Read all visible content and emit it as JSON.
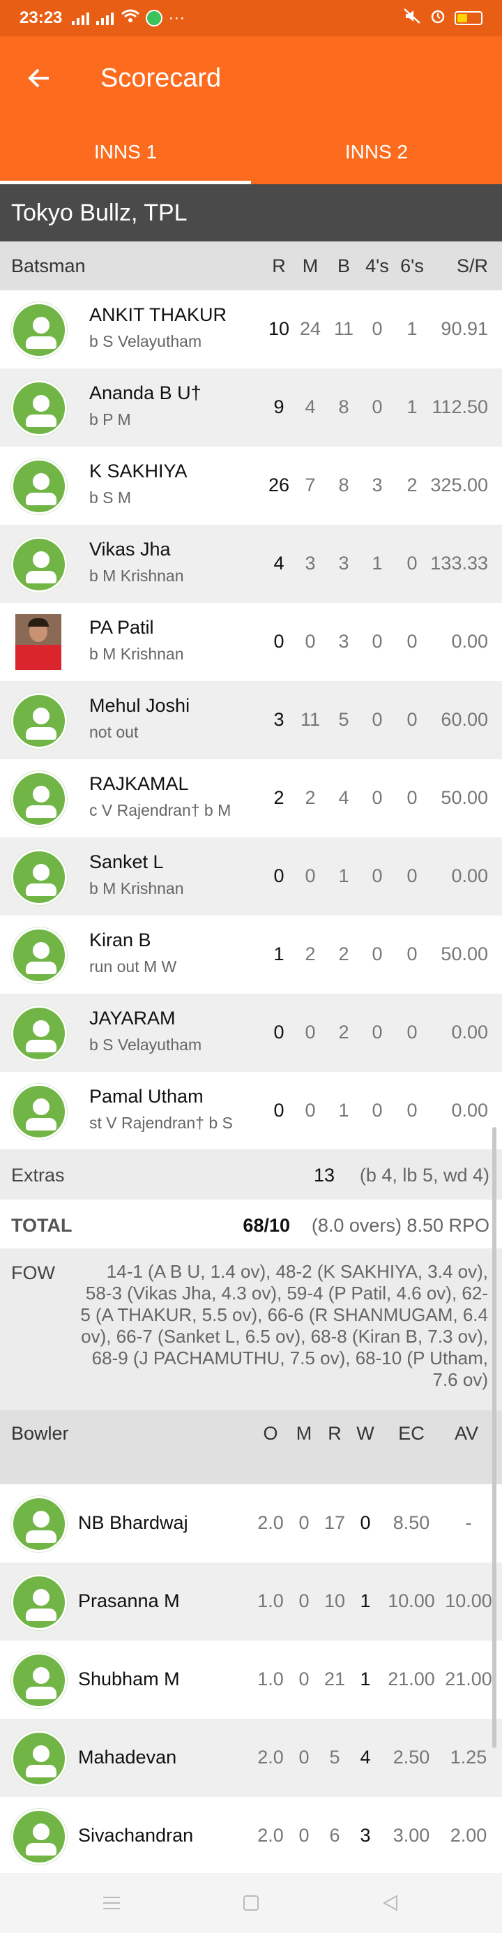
{
  "status": {
    "time": "23:23",
    "more": "···"
  },
  "header": {
    "title": "Scorecard"
  },
  "tabs": [
    {
      "label": "INNS 1",
      "active": true
    },
    {
      "label": "INNS 2",
      "active": false
    }
  ],
  "team_name": "Tokyo Bullz, TPL",
  "batting": {
    "headers": {
      "player": "Batsman",
      "r": "R",
      "m": "M",
      "b": "B",
      "fours": "4's",
      "sixes": "6's",
      "sr": "S/R"
    },
    "rows": [
      {
        "name": "ANKIT THAKUR",
        "dismissal": "b S Velayutham",
        "r": "10",
        "m": "24",
        "b": "11",
        "fours": "0",
        "sixes": "1",
        "sr": "90.91",
        "avatar": "default"
      },
      {
        "name": "Ananda B U†",
        "dismissal": "b P M",
        "r": "9",
        "m": "4",
        "b": "8",
        "fours": "0",
        "sixes": "1",
        "sr": "112.50",
        "avatar": "default"
      },
      {
        "name": "K SAKHIYA",
        "dismissal": "b S M",
        "r": "26",
        "m": "7",
        "b": "8",
        "fours": "3",
        "sixes": "2",
        "sr": "325.00",
        "avatar": "default"
      },
      {
        "name": "Vikas Jha",
        "dismissal": "b M Krishnan",
        "r": "4",
        "m": "3",
        "b": "3",
        "fours": "1",
        "sixes": "0",
        "sr": "133.33",
        "avatar": "default"
      },
      {
        "name": "PA Patil",
        "dismissal": "b M Krishnan",
        "r": "0",
        "m": "0",
        "b": "3",
        "fours": "0",
        "sixes": "0",
        "sr": "0.00",
        "avatar": "photo"
      },
      {
        "name": "Mehul Joshi",
        "dismissal": "not out",
        "r": "3",
        "m": "11",
        "b": "5",
        "fours": "0",
        "sixes": "0",
        "sr": "60.00",
        "avatar": "default"
      },
      {
        "name": "RAJKAMAL",
        "dismissal": "c V Rajendran† b M",
        "r": "2",
        "m": "2",
        "b": "4",
        "fours": "0",
        "sixes": "0",
        "sr": "50.00",
        "avatar": "default"
      },
      {
        "name": "Sanket L",
        "dismissal": "b M Krishnan",
        "r": "0",
        "m": "0",
        "b": "1",
        "fours": "0",
        "sixes": "0",
        "sr": "0.00",
        "avatar": "default"
      },
      {
        "name": "Kiran B",
        "dismissal": "run out M W",
        "r": "1",
        "m": "2",
        "b": "2",
        "fours": "0",
        "sixes": "0",
        "sr": "50.00",
        "avatar": "default"
      },
      {
        "name": "JAYARAM",
        "dismissal": "b S Velayutham",
        "r": "0",
        "m": "0",
        "b": "2",
        "fours": "0",
        "sixes": "0",
        "sr": "0.00",
        "avatar": "default"
      },
      {
        "name": "Pamal Utham",
        "dismissal": "st V Rajendran† b S",
        "r": "0",
        "m": "0",
        "b": "1",
        "fours": "0",
        "sixes": "0",
        "sr": "0.00",
        "avatar": "default"
      }
    ]
  },
  "extras": {
    "label": "Extras",
    "value": "13",
    "detail": "(b 4, lb 5, wd 4)"
  },
  "total": {
    "label": "TOTAL",
    "value": "68/10",
    "detail": "(8.0 overs) 8.50 RPO"
  },
  "fow": {
    "label": "FOW",
    "text": "14-1 (A B U, 1.4 ov), 48-2 (K SAKHIYA, 3.4 ov), 58-3 (Vikas Jha, 4.3 ov), 59-4 (P Patil, 4.6 ov), 62-5 (A THAKUR, 5.5 ov), 66-6 (R SHANMUGAM, 6.4 ov), 66-7 (Sanket L, 6.5 ov), 68-8 (Kiran B, 7.3 ov), 68-9 (J PACHAMUTHU, 7.5 ov), 68-10 (P Utham, 7.6 ov)"
  },
  "bowling": {
    "headers": {
      "player": "Bowler",
      "o": "O",
      "m": "M",
      "r": "R",
      "w": "W",
      "ec": "EC",
      "av": "AV"
    },
    "rows": [
      {
        "name": "NB Bhardwaj",
        "o": "2.0",
        "m": "0",
        "r": "17",
        "w": "0",
        "ec": "8.50",
        "av": "-"
      },
      {
        "name": "Prasanna M",
        "o": "1.0",
        "m": "0",
        "r": "10",
        "w": "1",
        "ec": "10.00",
        "av": "10.00"
      },
      {
        "name": "Shubham M",
        "o": "1.0",
        "m": "0",
        "r": "21",
        "w": "1",
        "ec": "21.00",
        "av": "21.00"
      },
      {
        "name": "Mahadevan",
        "o": "2.0",
        "m": "0",
        "r": "5",
        "w": "4",
        "ec": "2.50",
        "av": "1.25"
      },
      {
        "name": "Sivachandran",
        "o": "2.0",
        "m": "0",
        "r": "6",
        "w": "3",
        "ec": "3.00",
        "av": "2.00"
      }
    ]
  },
  "colors": {
    "accent": "#fc6b1e",
    "status_bar": "#e85e14",
    "avatar": "#72b547",
    "team_bar": "#4a4a4a"
  },
  "icons": {
    "back": "arrow-left-icon",
    "avatar": "user-avatar-icon",
    "nav_menu": "menu-icon",
    "nav_home": "square-home-icon",
    "nav_back": "triangle-back-icon"
  }
}
